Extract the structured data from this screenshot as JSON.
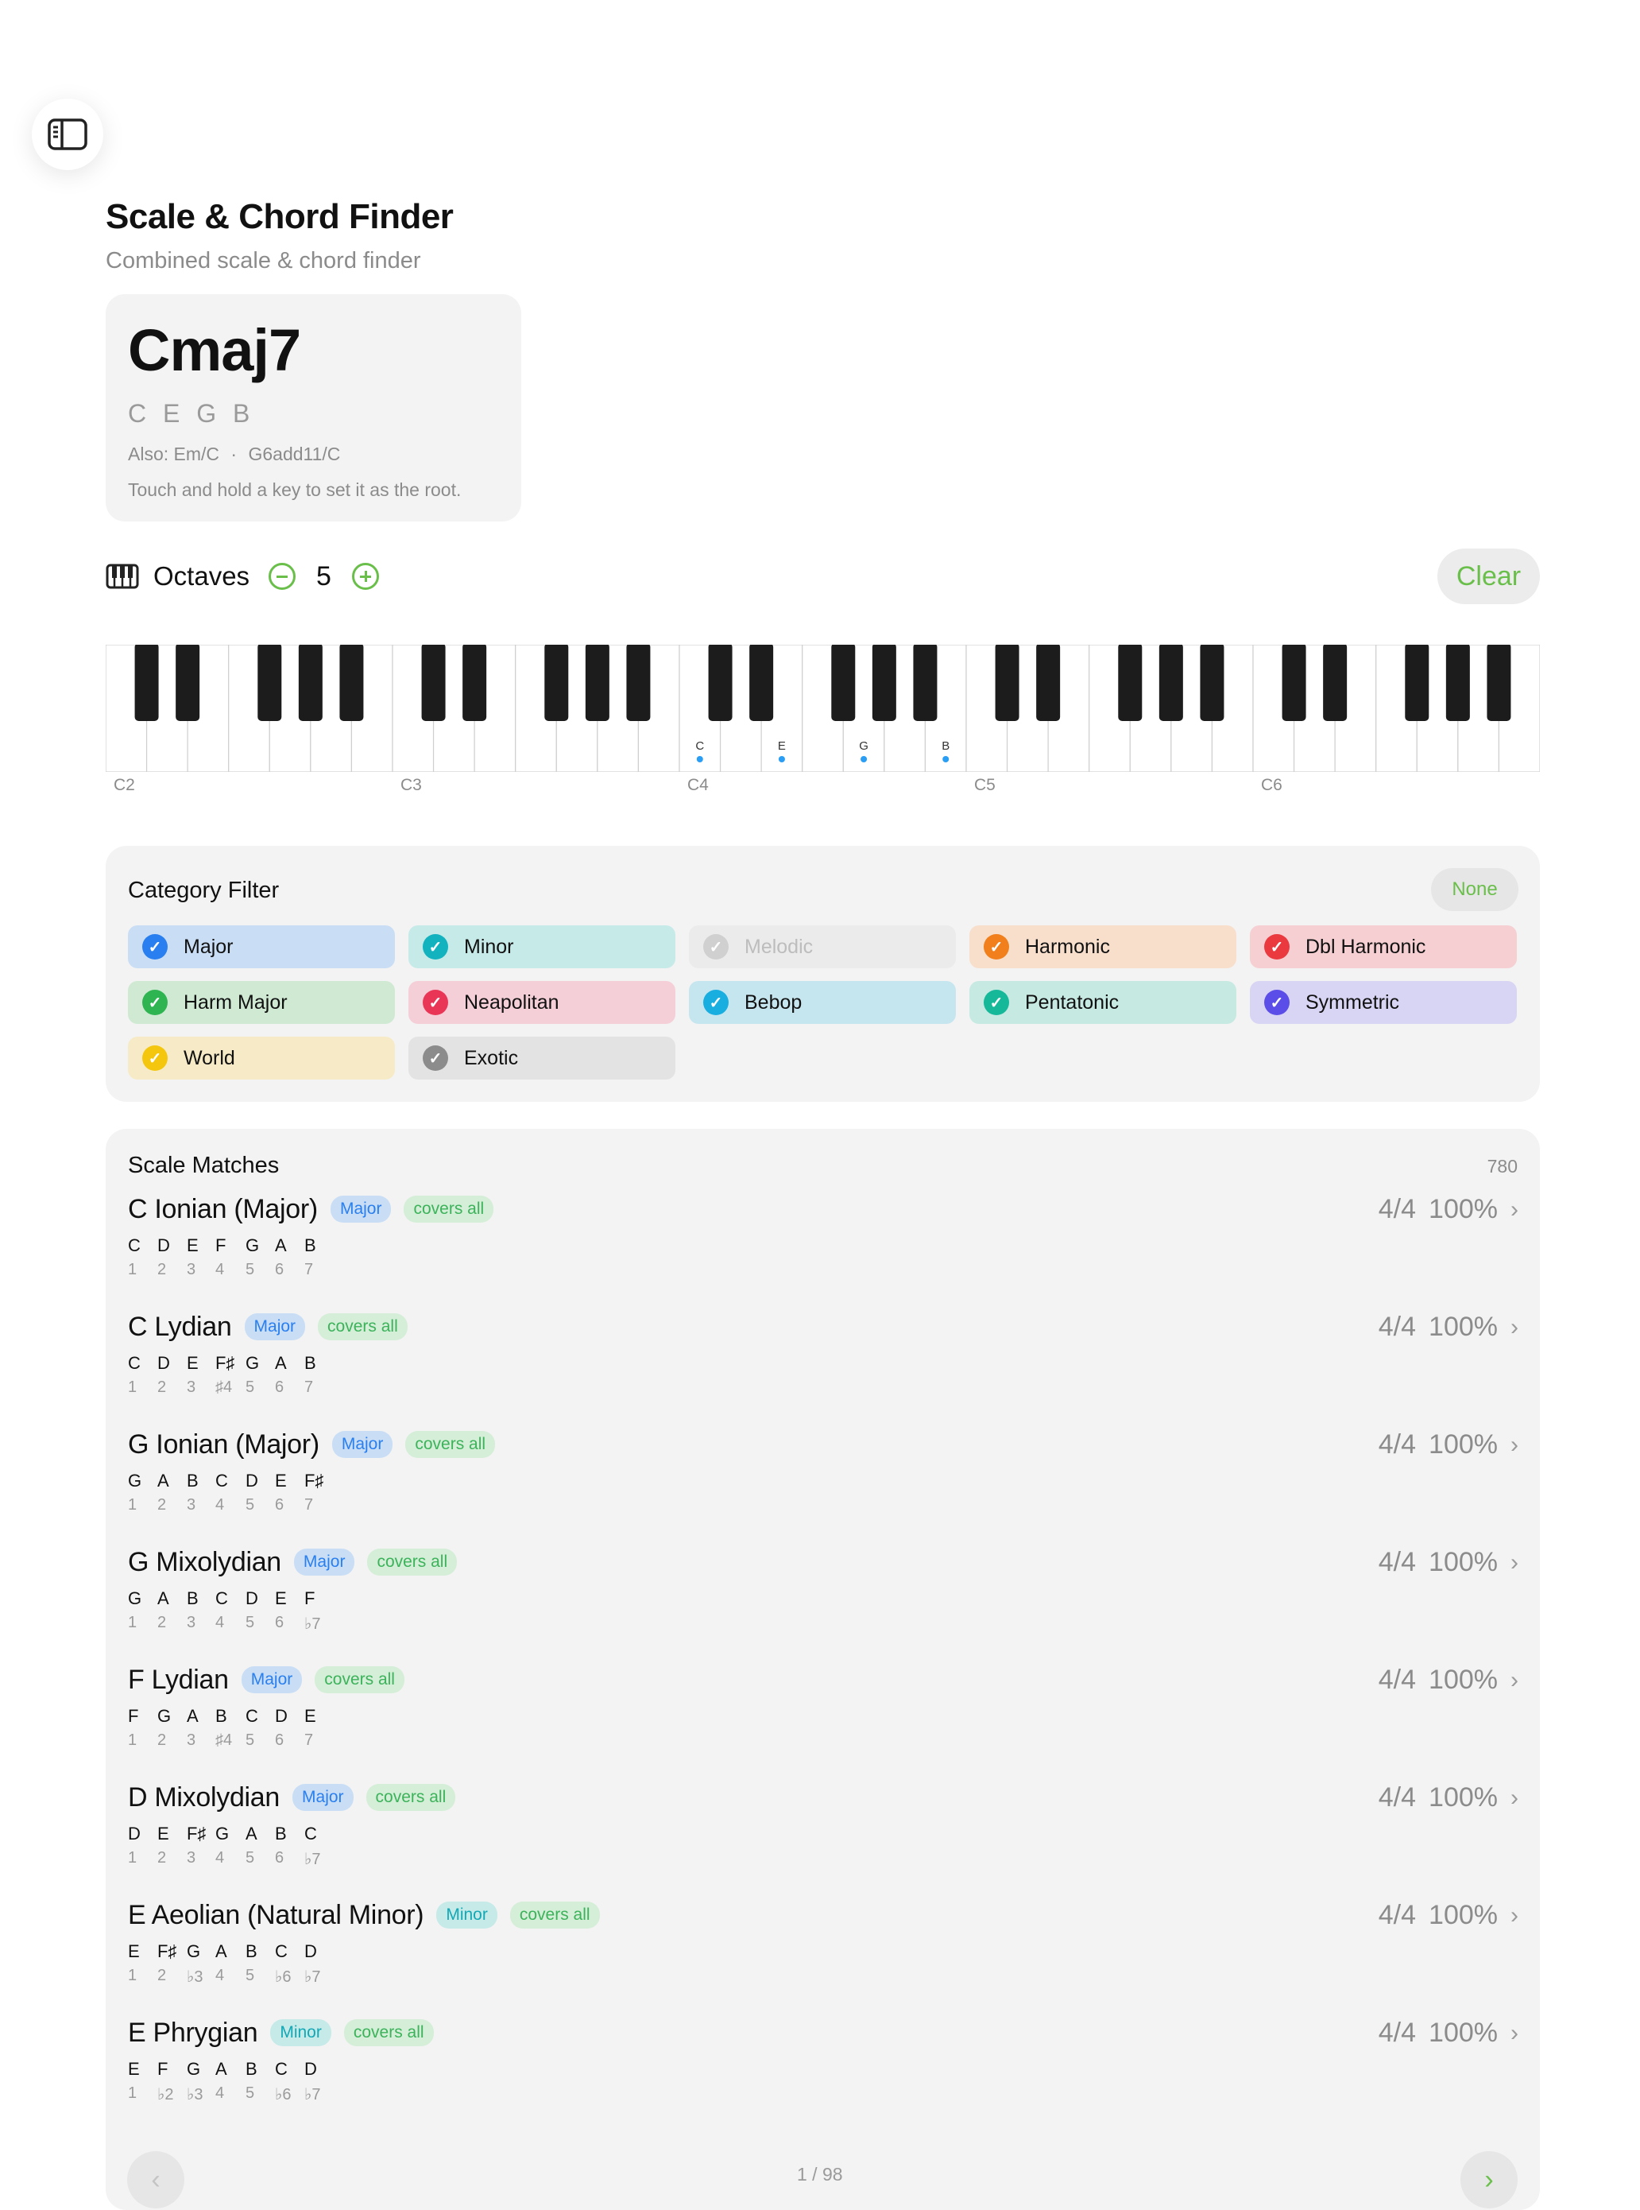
{
  "header": {
    "title": "Scale & Chord Finder",
    "subtitle": "Combined scale & chord finder",
    "sidebar_icon": "sidebar-icon"
  },
  "chord": {
    "name": "Cmaj7",
    "notes": "C E G B",
    "also_prefix": "Also: Em/C",
    "also_sep": "·",
    "also_second": "G6add11/C",
    "hint": "Touch and hold a key to set it as the root."
  },
  "octaves": {
    "icon": "piano-icon",
    "label": "Octaves",
    "value": "5",
    "clear_label": "Clear"
  },
  "keyboard": {
    "octave_labels": [
      "C2",
      "C3",
      "C4",
      "C5",
      "C6"
    ],
    "selected_notes": [
      "C",
      "E",
      "G",
      "B"
    ],
    "accent": "#2a9df4"
  },
  "filter": {
    "title": "Category Filter",
    "none_label": "None",
    "chips": [
      {
        "label": "Major",
        "bg": "#c9def5",
        "check": "#2a7ff0",
        "enabled": true
      },
      {
        "label": "Minor",
        "bg": "#c6eae8",
        "check": "#12b2bf",
        "enabled": true
      },
      {
        "label": "Melodic",
        "bg": "#ebebeb",
        "check": "#d0d0d0",
        "enabled": false
      },
      {
        "label": "Harmonic",
        "bg": "#f7dfcc",
        "check": "#f07f1c",
        "enabled": true
      },
      {
        "label": "Dbl Harmonic",
        "bg": "#f5cfd2",
        "check": "#ea3a3f",
        "enabled": true
      },
      {
        "label": "Harm Major",
        "bg": "#cfe9d3",
        "check": "#2fb452",
        "enabled": true
      },
      {
        "label": "Neapolitan",
        "bg": "#f5cfd8",
        "check": "#ea3656",
        "enabled": true
      },
      {
        "label": "Bebop",
        "bg": "#c6e6ef",
        "check": "#19aee0",
        "enabled": true
      },
      {
        "label": "Pentatonic",
        "bg": "#c6e9e2",
        "check": "#16b89a",
        "enabled": true
      },
      {
        "label": "Symmetric",
        "bg": "#d8d4f3",
        "check": "#5b4ee8",
        "enabled": true
      },
      {
        "label": "World",
        "bg": "#f6ebc6",
        "check": "#f4c60e",
        "enabled": true
      },
      {
        "label": "Exotic",
        "bg": "#e3e3e3",
        "check": "#8c8c8c",
        "enabled": true
      }
    ]
  },
  "matches": {
    "title": "Scale Matches",
    "count": "780",
    "rows": [
      {
        "name": "C Ionian (Major)",
        "tag": "Major",
        "covers": "covers all",
        "score": "4/4",
        "pct": "100%",
        "notes": [
          "C",
          "D",
          "E",
          "F",
          "G",
          "A",
          "B"
        ],
        "degrees": [
          "1",
          "2",
          "3",
          "4",
          "5",
          "6",
          "7"
        ]
      },
      {
        "name": "C Lydian",
        "tag": "Major",
        "covers": "covers all",
        "score": "4/4",
        "pct": "100%",
        "notes": [
          "C",
          "D",
          "E",
          "F♯",
          "G",
          "A",
          "B"
        ],
        "degrees": [
          "1",
          "2",
          "3",
          "♯4",
          "5",
          "6",
          "7"
        ]
      },
      {
        "name": "G Ionian (Major)",
        "tag": "Major",
        "covers": "covers all",
        "score": "4/4",
        "pct": "100%",
        "notes": [
          "G",
          "A",
          "B",
          "C",
          "D",
          "E",
          "F♯"
        ],
        "degrees": [
          "1",
          "2",
          "3",
          "4",
          "5",
          "6",
          "7"
        ]
      },
      {
        "name": "G Mixolydian",
        "tag": "Major",
        "covers": "covers all",
        "score": "4/4",
        "pct": "100%",
        "notes": [
          "G",
          "A",
          "B",
          "C",
          "D",
          "E",
          "F"
        ],
        "degrees": [
          "1",
          "2",
          "3",
          "4",
          "5",
          "6",
          "♭7"
        ]
      },
      {
        "name": "F Lydian",
        "tag": "Major",
        "covers": "covers all",
        "score": "4/4",
        "pct": "100%",
        "notes": [
          "F",
          "G",
          "A",
          "B",
          "C",
          "D",
          "E"
        ],
        "degrees": [
          "1",
          "2",
          "3",
          "♯4",
          "5",
          "6",
          "7"
        ]
      },
      {
        "name": "D Mixolydian",
        "tag": "Major",
        "covers": "covers all",
        "score": "4/4",
        "pct": "100%",
        "notes": [
          "D",
          "E",
          "F♯",
          "G",
          "A",
          "B",
          "C"
        ],
        "degrees": [
          "1",
          "2",
          "3",
          "4",
          "5",
          "6",
          "♭7"
        ]
      },
      {
        "name": "E Aeolian (Natural Minor)",
        "tag": "Minor",
        "covers": "covers all",
        "score": "4/4",
        "pct": "100%",
        "notes": [
          "E",
          "F♯",
          "G",
          "A",
          "B",
          "C",
          "D"
        ],
        "degrees": [
          "1",
          "2",
          "♭3",
          "4",
          "5",
          "♭6",
          "♭7"
        ]
      },
      {
        "name": "E Phrygian",
        "tag": "Minor",
        "covers": "covers all",
        "score": "4/4",
        "pct": "100%",
        "notes": [
          "E",
          "F",
          "G",
          "A",
          "B",
          "C",
          "D"
        ],
        "degrees": [
          "1",
          "♭2",
          "♭3",
          "4",
          "5",
          "♭6",
          "♭7"
        ]
      }
    ]
  },
  "pager": {
    "text": "1 / 98",
    "prev_icon": "chevron-left-icon",
    "next_icon": "chevron-right-icon"
  },
  "colors": {
    "accent_green": "#6abf4b",
    "major_tag_bg": "#c9def5",
    "major_tag_fg": "#2a7ff0",
    "minor_tag_bg": "#c6eae8",
    "minor_tag_fg": "#12a8b6",
    "covers_bg": "#d5eed8",
    "covers_fg": "#3cb35a"
  }
}
